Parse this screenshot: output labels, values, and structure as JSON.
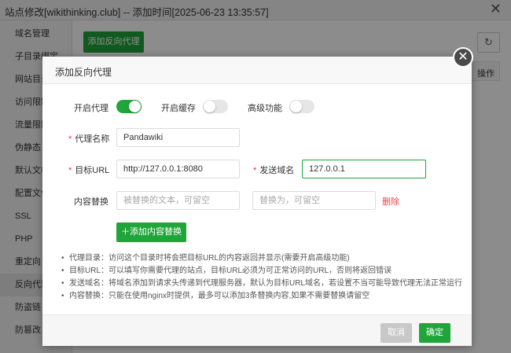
{
  "window": {
    "title": "站点修改[wikithinking.club] -- 添加时间[2025-06-23 13:35:57]",
    "close_glyph": "✕"
  },
  "sidebar": {
    "items": [
      {
        "label": "域名管理",
        "active": false
      },
      {
        "label": "子目录绑定",
        "active": false
      },
      {
        "label": "网站目录",
        "active": false
      },
      {
        "label": "访问限制",
        "active": false
      },
      {
        "label": "流量限制",
        "active": false
      },
      {
        "label": "伪静态",
        "active": false
      },
      {
        "label": "默认文档",
        "active": false
      },
      {
        "label": "配置文件",
        "active": false
      },
      {
        "label": "SSL",
        "active": false
      },
      {
        "label": "PHP",
        "active": false
      },
      {
        "label": "重定向",
        "active": false
      },
      {
        "label": "反向代理",
        "active": true
      },
      {
        "label": "防盗链",
        "active": false
      },
      {
        "label": "防篡改",
        "active": false
      }
    ]
  },
  "main": {
    "add_button": "添加反向代理",
    "refresh_glyph": "↻",
    "table_header_operation": "操作"
  },
  "dialog": {
    "title": "添加反向代理",
    "close_glyph": "✕",
    "toggles": {
      "enable_proxy": {
        "label": "开启代理",
        "on": true
      },
      "enable_cache": {
        "label": "开启缓存",
        "on": false
      },
      "advanced": {
        "label": "高级功能",
        "on": false
      }
    },
    "proxy_name": {
      "required_mark": "*",
      "label": "代理名称",
      "value": "Pandawiki"
    },
    "target_url": {
      "required_mark": "*",
      "label": "目标URL",
      "value": "http://127.0.0.1:8080"
    },
    "send_domain": {
      "required_mark": "*",
      "label": "发送域名",
      "value": "127.0.0.1"
    },
    "content_replace": {
      "label": "内容替换",
      "from_placeholder": "被替换的文本，可留空",
      "to_placeholder": "替换为，可留空",
      "delete_label": "删除"
    },
    "add_replace_button": "＋添加内容替换",
    "notes": [
      "代理目录：访问这个目录时将会把目标URL的内容返回并显示(需要开启高级功能)",
      "目标URL：可以填写你需要代理的站点，目标URL必须为可正常访问的URL，否则将返回错误",
      "发送域名：将域名添加到请求头传递到代理服务器，默认为目标URL域名，若设置不当可能导致代理无法正常运行",
      "内容替换：只能在使用nginx时提供，最多可以添加3条替换内容,如果不需要替换请留空"
    ],
    "cancel_button": "取消",
    "ok_button": "确定"
  },
  "colors": {
    "accent_green": "#20a53a",
    "required_red": "#ee3333",
    "delete_red": "#ee4444"
  }
}
